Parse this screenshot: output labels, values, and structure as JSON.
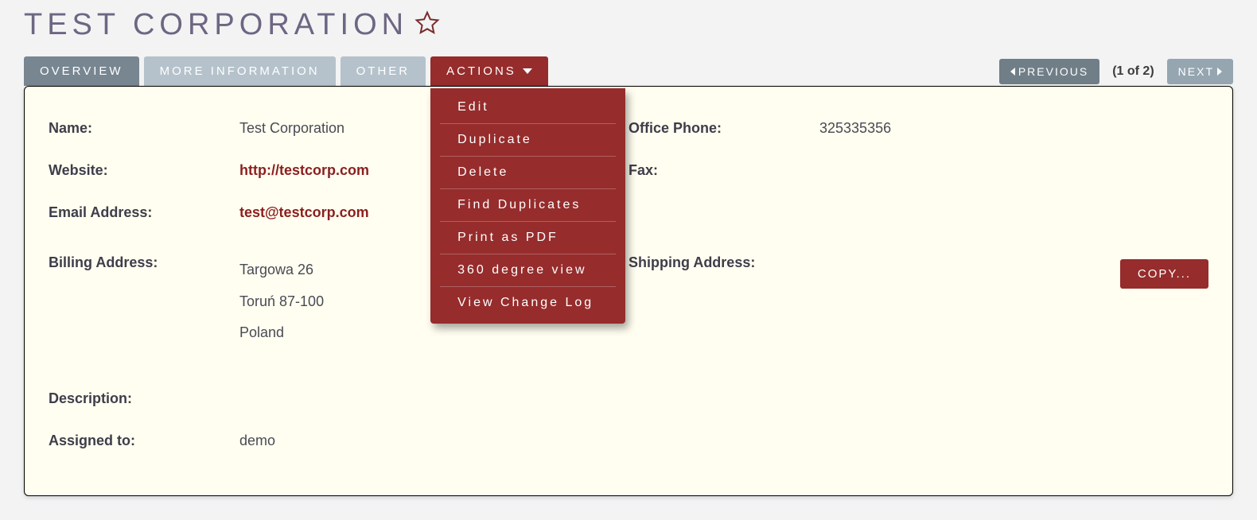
{
  "header": {
    "title": "TEST CORPORATION"
  },
  "tabs": {
    "overview": "OVERVIEW",
    "more_info": "MORE INFORMATION",
    "other": "OTHER",
    "actions": "ACTIONS"
  },
  "actions_menu": {
    "edit": "Edit",
    "duplicate": "Duplicate",
    "delete": "Delete",
    "find_duplicates": "Find Duplicates",
    "print_pdf": "Print as PDF",
    "degree_view": "360 degree view",
    "change_log": "View Change Log"
  },
  "navigation": {
    "previous": "PREVIOUS",
    "next": "NEXT",
    "indicator": "(1 of 2)"
  },
  "fields": {
    "name_label": "Name:",
    "name_value": "Test Corporation",
    "website_label": "Website:",
    "website_value": "http://testcorp.com",
    "email_label": "Email Address:",
    "email_value": "test@testcorp.com",
    "office_phone_label": "Office Phone:",
    "office_phone_value": "325335356",
    "fax_label": "Fax:",
    "fax_value": "",
    "billing_label": "Billing Address:",
    "billing_line1": "Targowa 26",
    "billing_line2": "Toruń  87-100",
    "billing_line3": "Poland",
    "shipping_label": "Shipping Address:",
    "shipping_value": "",
    "description_label": "Description:",
    "description_value": "",
    "assigned_label": "Assigned to:",
    "assigned_value": "demo"
  },
  "buttons": {
    "copy": "COPY..."
  }
}
